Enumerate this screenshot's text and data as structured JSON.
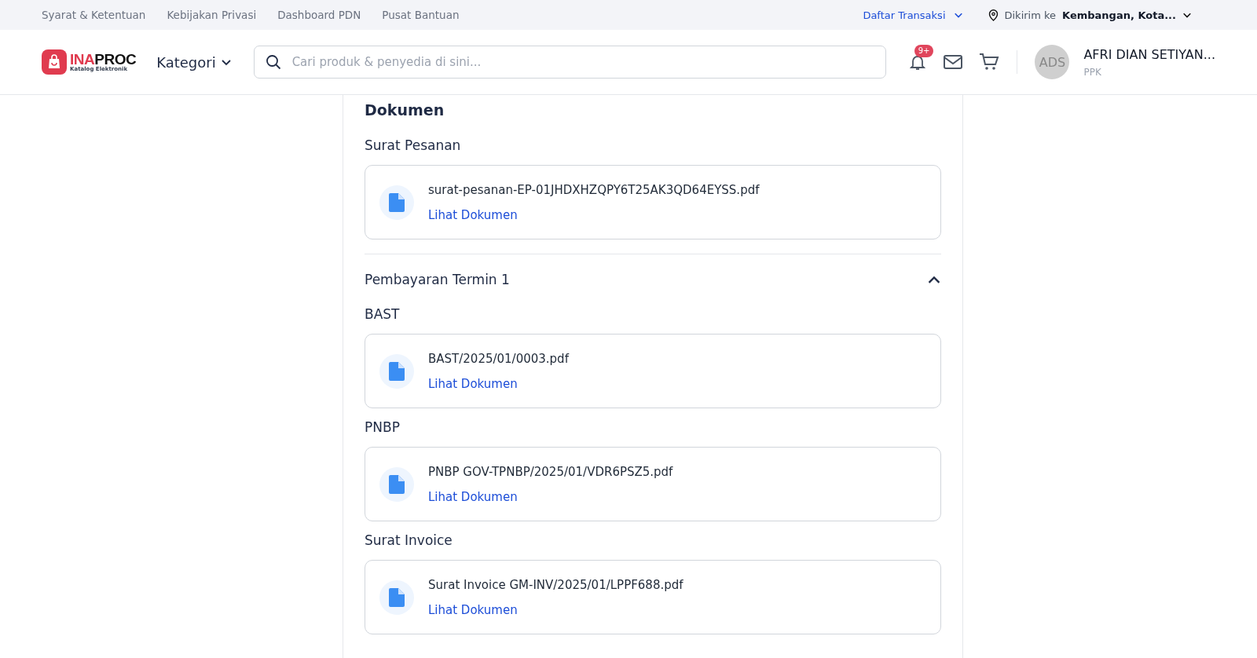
{
  "topbar": {
    "links": [
      "Syarat & Ketentuan",
      "Kebijakan Privasi",
      "Dashboard PDN",
      "Pusat Bantuan"
    ],
    "transactions": "Daftar Transaksi",
    "ship_label": "Dikirim ke",
    "ship_place": "Kembangan, Kota..."
  },
  "header": {
    "logo": {
      "primary": "INA",
      "secondary": "PROC",
      "tagline": "Katalog Elektronik"
    },
    "category": "Kategori",
    "search": {
      "placeholder": "Cari produk & penyedia di sini..."
    },
    "notifications": "9+",
    "user": {
      "initials": "ADS",
      "name": "AFRI DIAN SETIYAN...",
      "role": "PPK"
    }
  },
  "documents": {
    "title": "Dokumen",
    "groups": [
      {
        "label": "Surat Pesanan",
        "file": "surat-pesanan-EP-01JHDXHZQPY6T25AK3QD64EYSS.pdf",
        "action": "Lihat Dokumen"
      }
    ],
    "sections": [
      {
        "title": "Pembayaran Termin 1",
        "expanded": true,
        "groups": [
          {
            "label": "BAST",
            "file": "BAST/2025/01/0003.pdf",
            "action": "Lihat Dokumen"
          },
          {
            "label": "PNBP",
            "file": "PNBP GOV-TPNBP/2025/01/VDR6PSZ5.pdf",
            "action": "Lihat Dokumen"
          },
          {
            "label": "Surat Invoice",
            "file": "Surat Invoice GM-INV/2025/01/LPPF688.pdf",
            "action": "Lihat Dokumen"
          }
        ]
      }
    ]
  }
}
